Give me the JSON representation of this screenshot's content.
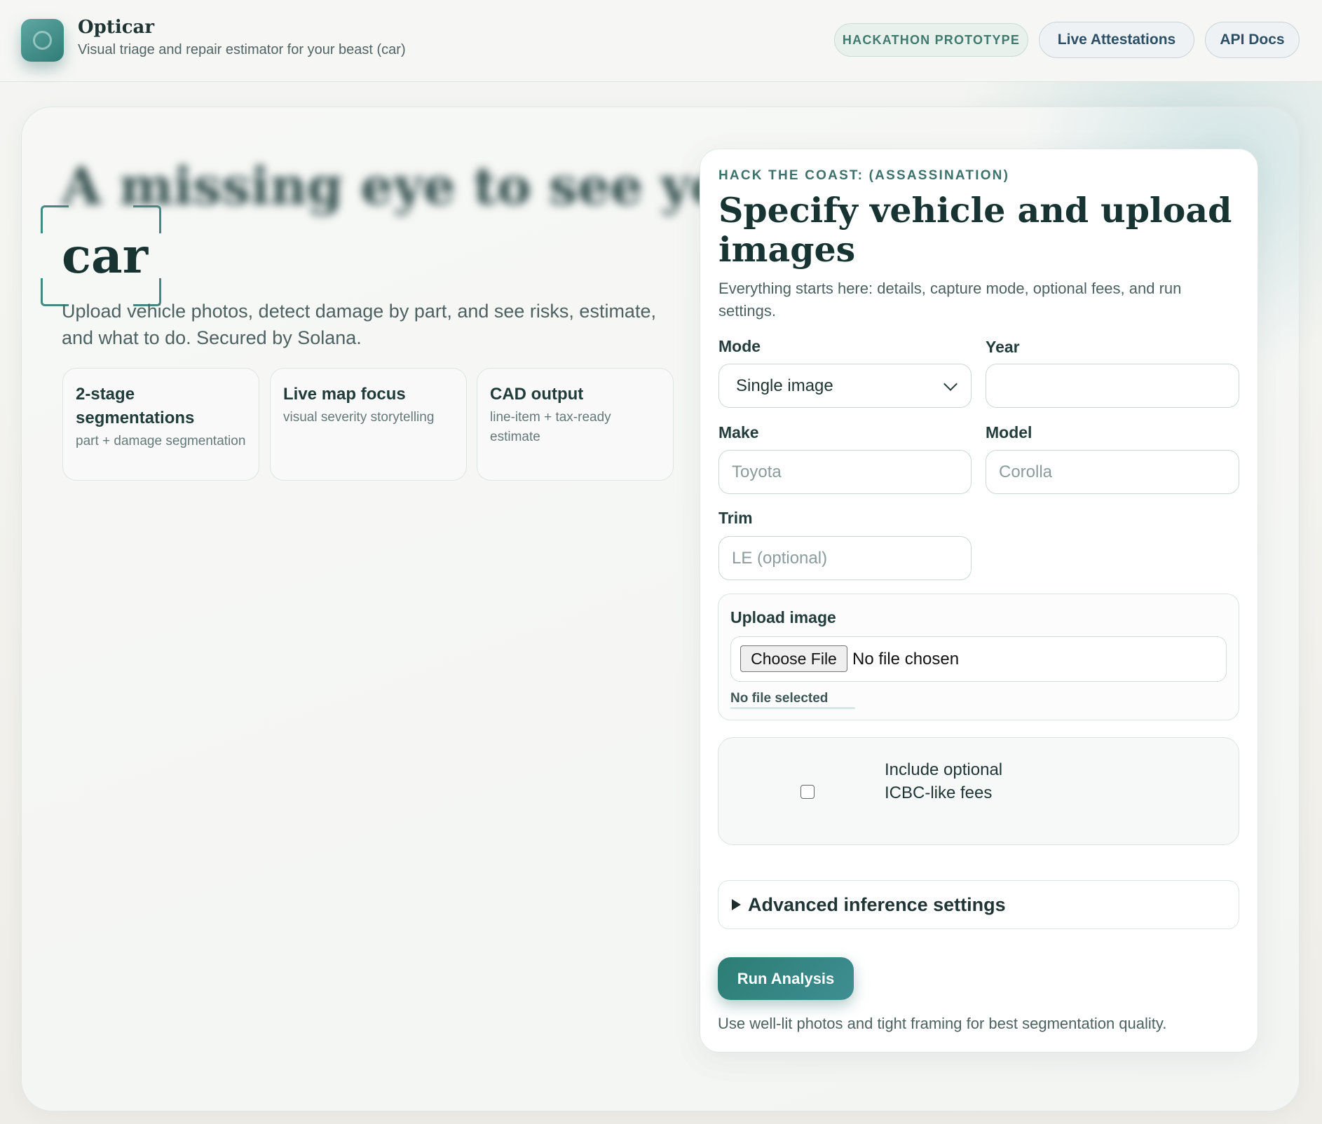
{
  "header": {
    "brand_name": "Opticar",
    "tagline": "Visual triage and repair estimator for your beast (car)",
    "badge": "HACKATHON PROTOTYPE",
    "links": [
      "Live Attestations",
      "API Docs"
    ]
  },
  "hero": {
    "title_blurred": "A missing eye to see your",
    "title_focus_word": "car",
    "subtitle": "Upload vehicle photos, detect damage by part, and see risks, estimate, and what to do. Secured by Solana.",
    "features": [
      {
        "title": "2-stage segmentations",
        "desc": "part + damage segmentation"
      },
      {
        "title": "Live map focus",
        "desc": "visual severity storytelling"
      },
      {
        "title": "CAD output",
        "desc": "line-item + tax-ready estimate"
      }
    ]
  },
  "form": {
    "kicker": "HACK THE COAST: (ASSASSINATION)",
    "title": "Specify vehicle and upload images",
    "description": "Everything starts here: details, capture mode, optional fees, and run settings.",
    "mode": {
      "label": "Mode",
      "value": "Single image"
    },
    "year": {
      "label": "Year",
      "value": ""
    },
    "make": {
      "label": "Make",
      "placeholder": "Toyota"
    },
    "model": {
      "label": "Model",
      "placeholder": "Corolla"
    },
    "trim": {
      "label": "Trim",
      "placeholder": "LE (optional)"
    },
    "upload": {
      "label": "Upload image",
      "button": "Choose File",
      "status": "No file chosen",
      "note": "No file selected"
    },
    "fees": {
      "label": "Include optional ICBC-like fees",
      "checked": false
    },
    "advanced": {
      "label": "Advanced inference settings"
    },
    "run_button": "Run Analysis",
    "hint": "Use well-lit photos and tight framing for best segmentation quality."
  },
  "colors": {
    "accent": "#2c7d74",
    "accent_light": "#3f8e93",
    "ink": "#173432",
    "badge_text": "#3f7a6d"
  }
}
